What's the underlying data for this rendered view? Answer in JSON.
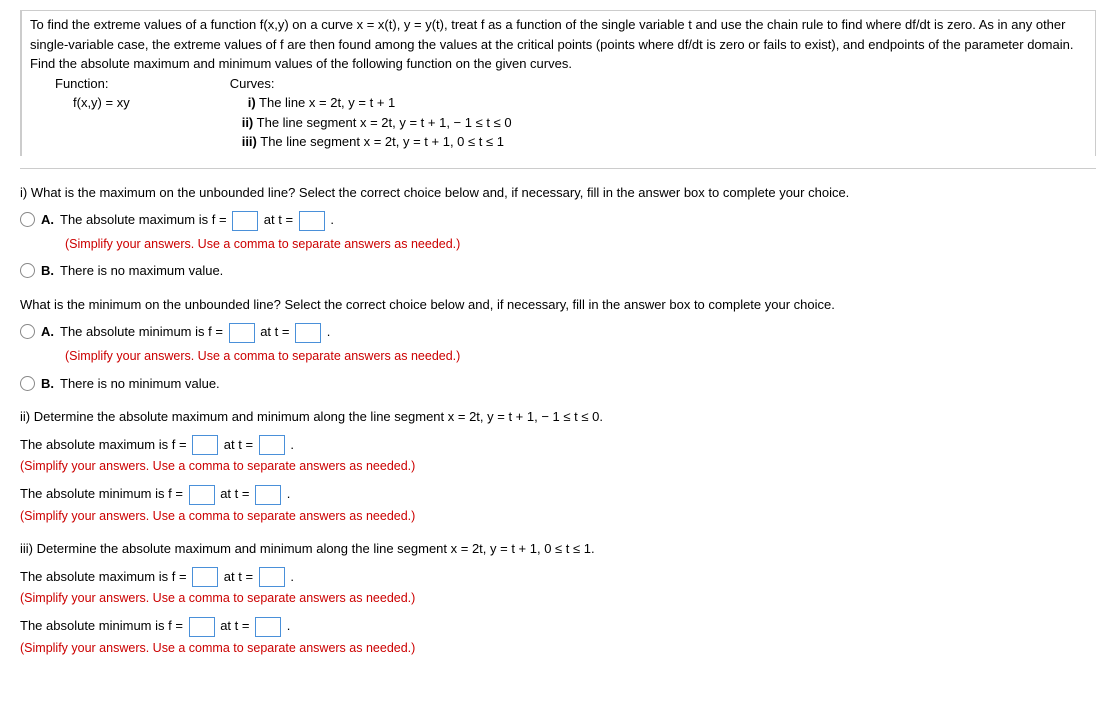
{
  "problem": {
    "intro": "To find the extreme values of a function f(x,y) on a curve x = x(t), y = y(t), treat f as a function of the single variable t and use the chain rule to find where df/dt is zero. As in any other single-variable case, the extreme values of f are then found among the values at the critical points (points where df/dt is zero or fails to exist), and endpoints of the parameter domain. Find the absolute maximum and minimum values of the following function on the given curves.",
    "function_label": "Function:",
    "function": "f(x,y) = xy",
    "curves_label": "Curves:",
    "curve_i": "i)  The line x = 2t, y = t + 1",
    "curve_ii": "ii) The line segment x = 2t, y = t + 1,  − 1 ≤ t ≤ 0",
    "curve_iii": "iii) The line segment x = 2t, y = t + 1, 0 ≤ t ≤ 1"
  },
  "parts": {
    "i_max_q": "i) What is the maximum on the unbounded line? Select the correct choice below and, if necessary, fill in the answer box to complete your choice.",
    "i_max_optA_pre": "The absolute maximum is f =",
    "at_t": " at t =",
    "period": ".",
    "simplify_hint": "(Simplify your answers. Use a comma to separate answers as needed.)",
    "i_max_optB": "There is no maximum value.",
    "i_min_q": "What is the minimum on the unbounded line? Select the correct choice below and, if necessary, fill in the answer box to complete your choice.",
    "i_min_optA_pre": "The absolute minimum is f =",
    "i_min_optB": "There is no minimum value.",
    "ii_q": "ii) Determine the absolute maximum and minimum along the line segment x = 2t, y = t + 1,  − 1 ≤ t ≤ 0.",
    "abs_max_pre": "The absolute maximum is f =",
    "abs_min_pre": "The absolute minimum is f =",
    "iii_q": "iii) Determine the absolute maximum and minimum along the line segment x = 2t, y = t + 1, 0 ≤ t ≤ 1."
  },
  "labels": {
    "A": "A.",
    "B": "B."
  }
}
